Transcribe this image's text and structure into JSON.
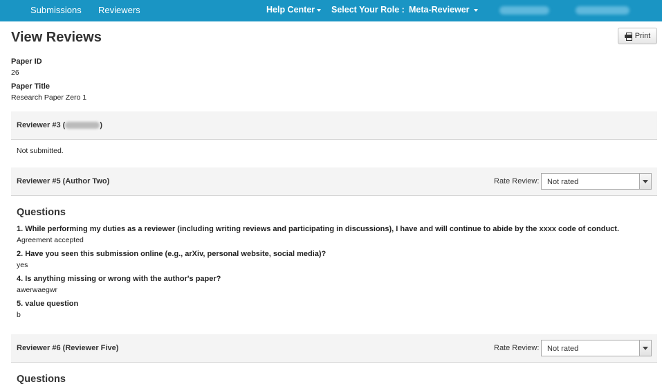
{
  "nav": {
    "submissions": "Submissions",
    "reviewers": "Reviewers",
    "help_center": "Help Center",
    "select_role_label": "Select Your Role :",
    "role": "Meta-Reviewer"
  },
  "page": {
    "title": "View Reviews",
    "print_label": "Print"
  },
  "paper": {
    "id_label": "Paper ID",
    "id_value": "26",
    "title_label": "Paper Title",
    "title_value": "Research Paper Zero 1"
  },
  "reviews": [
    {
      "title_prefix": "Reviewer #3 (",
      "title_suffix": ")",
      "status": "Not submitted."
    },
    {
      "title": "Reviewer #5 (Author Two)",
      "rate_label": "Rate Review:",
      "rating": "Not rated",
      "questions_heading": "Questions",
      "questions": [
        {
          "q": "1. While performing my duties as a reviewer (including writing reviews and participating in discussions), I have and will continue to abide by the xxxx code of conduct.",
          "a": "Agreement accepted"
        },
        {
          "q": "2. Have you seen this submission online (e.g., arXiv, personal website, social media)?",
          "a": "yes"
        },
        {
          "q": "4. Is anything missing or wrong with the author's paper?",
          "a": "awerwaegwr"
        },
        {
          "q": "5. value question",
          "a": "b"
        }
      ]
    },
    {
      "title": "Reviewer #6 (Reviewer Five)",
      "rate_label": "Rate Review:",
      "rating": "Not rated",
      "questions_heading": "Questions"
    }
  ]
}
